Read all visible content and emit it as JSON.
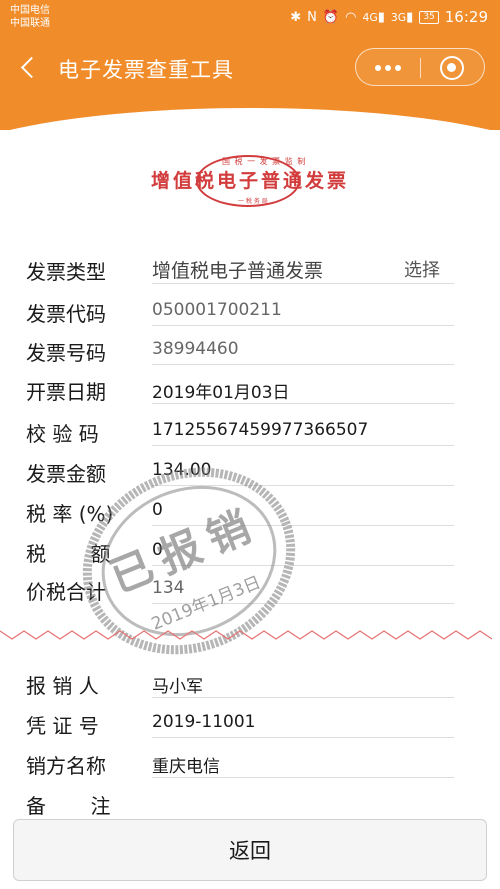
{
  "status_bar": {
    "carrier_1": "中国电信",
    "carrier_2": "中国联通",
    "signal_4g": "4G",
    "signal_3g": "3G",
    "battery": "35",
    "time": "16:29"
  },
  "navbar": {
    "title": "电子发票查重工具"
  },
  "invoice": {
    "title": "增值税电子普通发票",
    "seal_top": "国 税 一 发 票 监 制",
    "seal_bottom": "一 税 务 局"
  },
  "invoice_fields": {
    "type": {
      "label": "发票类型",
      "value": "增值税电子普通发票",
      "action": "选择"
    },
    "code": {
      "label": "发票代码",
      "value": "050001700211"
    },
    "number": {
      "label": "发票号码",
      "value": "38994460"
    },
    "date": {
      "label": "开票日期",
      "value": "2019年01月03日"
    },
    "check_code": {
      "label": "校 验 码",
      "value": "17125567459977366507"
    },
    "amount": {
      "label": "发票金额",
      "value": "134.00"
    },
    "tax_rate": {
      "label": "税 率 (%)",
      "value": "0"
    },
    "tax": {
      "label": "税       额",
      "value": "0"
    },
    "total": {
      "label": "价税合计",
      "value": "134"
    }
  },
  "stamp": {
    "text": "已报销",
    "date": "2019年1月3日"
  },
  "reimburse_fields": {
    "person": {
      "label": "报 销 人",
      "value": "马小军"
    },
    "voucher": {
      "label": "凭 证 号",
      "value": "2019-11001"
    },
    "seller": {
      "label": "销方名称",
      "value": "重庆电信"
    },
    "remark": {
      "label": "备       注",
      "value": ""
    }
  },
  "footer": {
    "return_label": "返回"
  },
  "colors": {
    "header": "#f08c2a",
    "seal_red": "#d23c3c",
    "zigzag": "#e57373"
  }
}
